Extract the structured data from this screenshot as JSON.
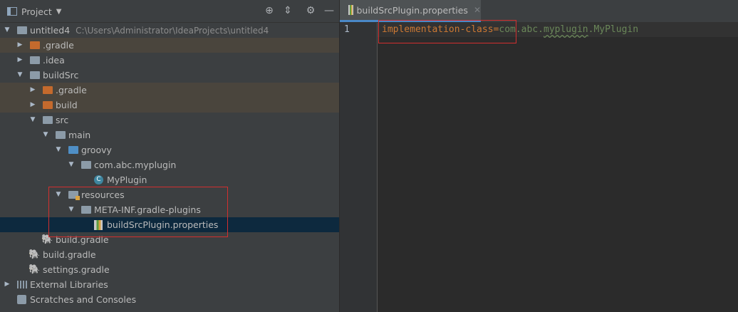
{
  "panel": {
    "title": "Project",
    "header_icons": [
      "crosshair-icon",
      "collapse-icon",
      "gear-icon",
      "minimize-icon"
    ]
  },
  "tree": [
    {
      "label": "untitled4",
      "path": "C:\\Users\\Administrator\\IdeaProjects\\untitled4",
      "icon": "module-folder-icon"
    },
    {
      "label": ".gradle",
      "icon": "excluded-folder-icon"
    },
    {
      "label": ".idea",
      "icon": "folder-icon"
    },
    {
      "label": "buildSrc",
      "icon": "module-folder-icon"
    },
    {
      "label": ".gradle",
      "icon": "excluded-folder-icon"
    },
    {
      "label": "build",
      "icon": "excluded-folder-icon"
    },
    {
      "label": "src",
      "icon": "folder-icon"
    },
    {
      "label": "main",
      "icon": "folder-icon"
    },
    {
      "label": "groovy",
      "icon": "source-folder-icon"
    },
    {
      "label": "com.abc.myplugin",
      "icon": "package-icon"
    },
    {
      "label": "MyPlugin",
      "icon": "groovy-class-icon"
    },
    {
      "label": "resources",
      "icon": "resources-folder-icon"
    },
    {
      "label": "META-INF.gradle-plugins",
      "icon": "package-icon"
    },
    {
      "label": "buildSrcPlugin.properties",
      "icon": "properties-file-icon"
    },
    {
      "label": "build.gradle",
      "icon": "gradle-icon"
    },
    {
      "label": "build.gradle",
      "icon": "gradle-icon"
    },
    {
      "label": "settings.gradle",
      "icon": "gradle-icon"
    },
    {
      "label": "External Libraries",
      "icon": "libraries-icon"
    },
    {
      "label": "Scratches and Consoles",
      "icon": "scratches-icon"
    }
  ],
  "editor": {
    "tab_label": "buildSrcPlugin.properties",
    "tab_close": "✕",
    "line_number": "1",
    "code": {
      "key": "implementation-class",
      "eq": "=",
      "value_part1": "com.abc.",
      "value_part2": "myplugin",
      "value_part3": ".",
      "value_part4": "MyPlugin"
    }
  },
  "colors": {
    "annotation_box": "#d22f2f",
    "selection": "#0d293e",
    "excluded_row": "#4a453d"
  }
}
